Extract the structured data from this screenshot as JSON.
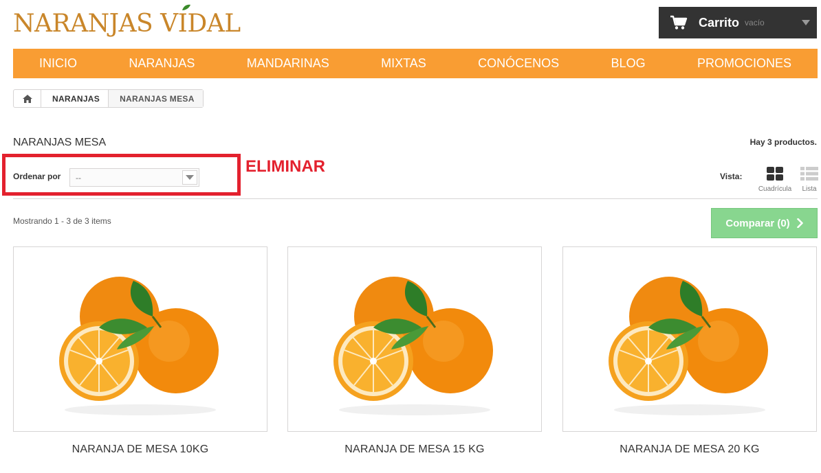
{
  "header": {
    "logo_text": "NARANJAS VIDAL",
    "cart_label": "Carrito",
    "cart_status": "vacío"
  },
  "nav": {
    "items": [
      "INICIO",
      "NARANJAS",
      "MANDARINAS",
      "MIXTAS",
      "CONÓCENOS",
      "BLOG",
      "PROMOCIONES"
    ]
  },
  "breadcrumb": {
    "home_icon": "home-icon",
    "items": [
      "NARANJAS",
      "NARANJAS MESA"
    ]
  },
  "category": {
    "title": "NARANJAS MESA",
    "product_count": "Hay 3 productos."
  },
  "annotation": {
    "label": "ELIMINAR",
    "color": "#e3212e"
  },
  "sort": {
    "label": "Ordenar por",
    "selected": "--"
  },
  "view": {
    "label": "Vista:",
    "grid_label": "Cuadrícula",
    "list_label": "Lista"
  },
  "listing": {
    "showing_text": "Mostrando 1 - 3 de 3 items",
    "compare_label": "Comparar (0)"
  },
  "products": [
    {
      "name": "NARANJA DE MESA 10KG",
      "image": "oranges-image"
    },
    {
      "name": "NARANJA DE MESA 15 KG",
      "image": "oranges-image"
    },
    {
      "name": "NARANJA DE MESA 20 KG",
      "image": "oranges-image"
    }
  ],
  "colors": {
    "brand_orange": "#f99d33",
    "logo_gold": "#c9862a",
    "cart_bg": "#333333",
    "compare_green": "#82d48a"
  }
}
